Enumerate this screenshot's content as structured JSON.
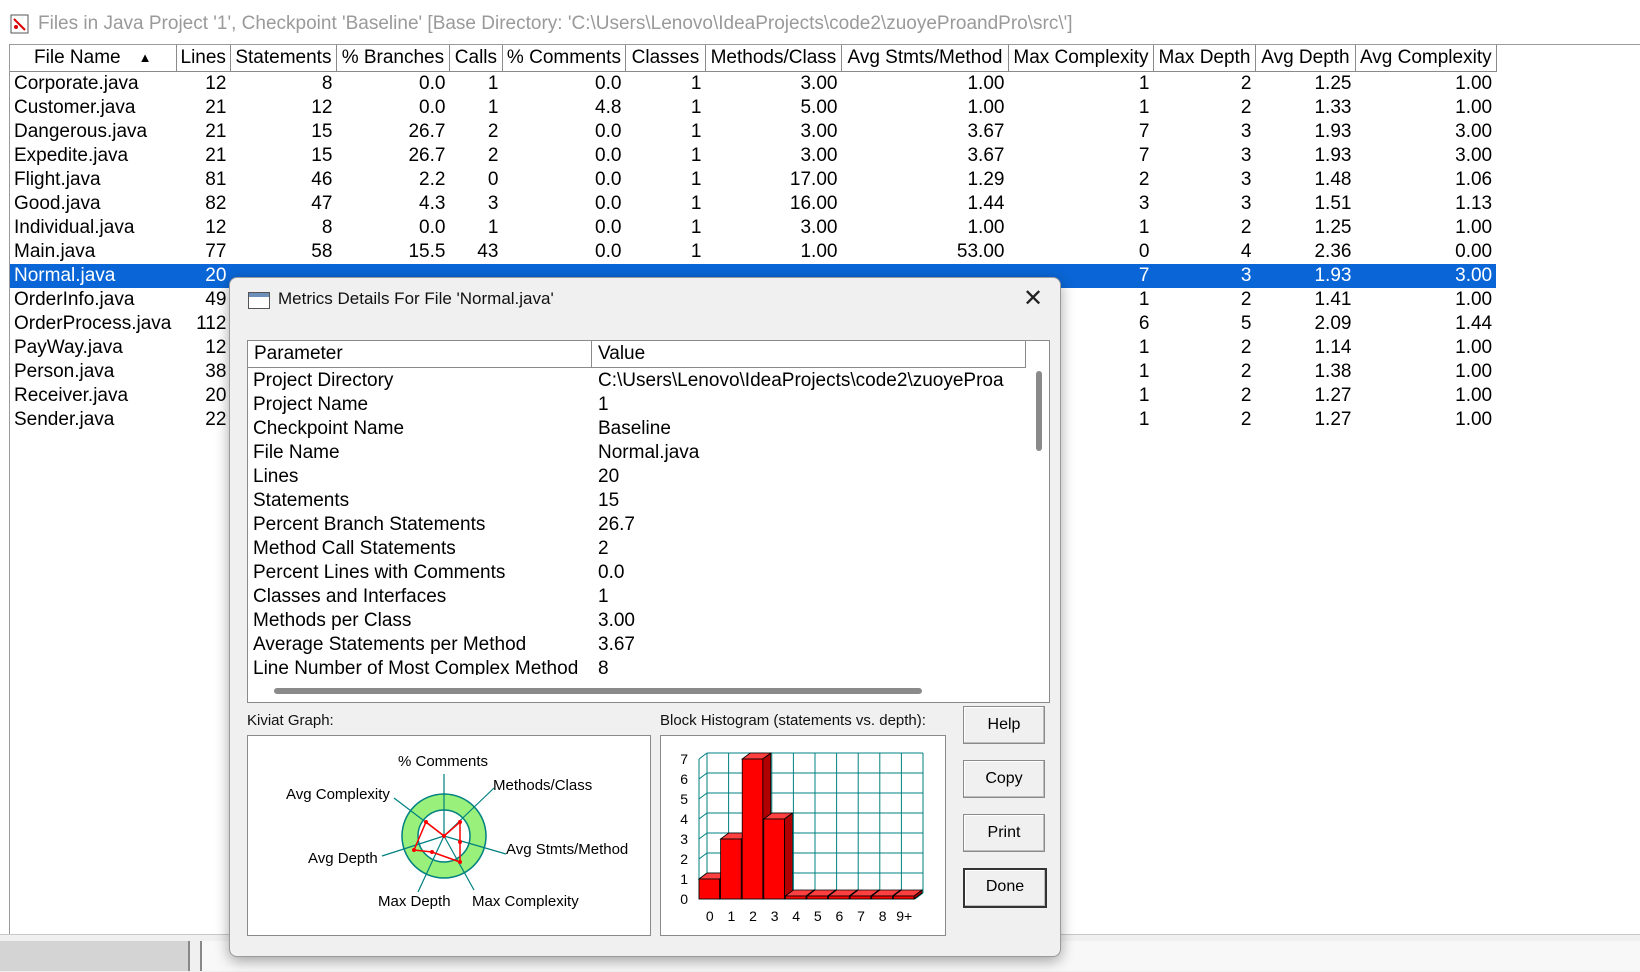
{
  "window": {
    "title": "Files in Java Project '1', Checkpoint 'Baseline'  [Base Directory: 'C:\\Users\\Lenovo\\IdeaProjects\\code2\\zuoyeProandPro\\src\\']"
  },
  "table": {
    "columns": [
      "File Name",
      "Lines",
      "Statements",
      "% Branches",
      "Calls",
      "% Comments",
      "Classes",
      "Methods/Class",
      "Avg Stmts/Method",
      "Max Complexity",
      "Max Depth",
      "Avg Depth",
      "Avg Complexity"
    ],
    "sorted_column": "File Name",
    "selected_row": "Normal.java",
    "rows": [
      [
        "Corporate.java",
        "12",
        "8",
        "0.0",
        "1",
        "0.0",
        "1",
        "3.00",
        "1.00",
        "1",
        "2",
        "1.25",
        "1.00"
      ],
      [
        "Customer.java",
        "21",
        "12",
        "0.0",
        "1",
        "4.8",
        "1",
        "5.00",
        "1.00",
        "1",
        "2",
        "1.33",
        "1.00"
      ],
      [
        "Dangerous.java",
        "21",
        "15",
        "26.7",
        "2",
        "0.0",
        "1",
        "3.00",
        "3.67",
        "7",
        "3",
        "1.93",
        "3.00"
      ],
      [
        "Expedite.java",
        "21",
        "15",
        "26.7",
        "2",
        "0.0",
        "1",
        "3.00",
        "3.67",
        "7",
        "3",
        "1.93",
        "3.00"
      ],
      [
        "Flight.java",
        "81",
        "46",
        "2.2",
        "0",
        "0.0",
        "1",
        "17.00",
        "1.29",
        "2",
        "3",
        "1.48",
        "1.06"
      ],
      [
        "Good.java",
        "82",
        "47",
        "4.3",
        "3",
        "0.0",
        "1",
        "16.00",
        "1.44",
        "3",
        "3",
        "1.51",
        "1.13"
      ],
      [
        "Individual.java",
        "12",
        "8",
        "0.0",
        "1",
        "0.0",
        "1",
        "3.00",
        "1.00",
        "1",
        "2",
        "1.25",
        "1.00"
      ],
      [
        "Main.java",
        "77",
        "58",
        "15.5",
        "43",
        "0.0",
        "1",
        "1.00",
        "53.00",
        "0",
        "4",
        "2.36",
        "0.00"
      ],
      [
        "Normal.java",
        "20",
        "",
        "",
        "",
        "",
        "",
        "",
        "",
        "7",
        "3",
        "1.93",
        "3.00"
      ],
      [
        "OrderInfo.java",
        "49",
        "",
        "",
        "",
        "",
        "",
        "",
        "",
        "1",
        "2",
        "1.41",
        "1.00"
      ],
      [
        "OrderProcess.java",
        "112",
        "",
        "",
        "",
        "",
        "",
        "",
        "",
        "6",
        "5",
        "2.09",
        "1.44"
      ],
      [
        "PayWay.java",
        "12",
        "",
        "",
        "",
        "",
        "",
        "",
        "",
        "1",
        "2",
        "1.14",
        "1.00"
      ],
      [
        "Person.java",
        "38",
        "",
        "",
        "",
        "",
        "",
        "",
        "",
        "1",
        "2",
        "1.38",
        "1.00"
      ],
      [
        "Receiver.java",
        "20",
        "",
        "",
        "",
        "",
        "",
        "",
        "",
        "1",
        "2",
        "1.27",
        "1.00"
      ],
      [
        "Sender.java",
        "22",
        "",
        "",
        "",
        "",
        "",
        "",
        "",
        "1",
        "2",
        "1.27",
        "1.00"
      ]
    ]
  },
  "dialog": {
    "title": "Metrics Details For File 'Normal.java'",
    "close_glyph": "✕",
    "list_headers": [
      "Parameter",
      "Value"
    ],
    "params": [
      {
        "p": "Project Directory",
        "v": "C:\\Users\\Lenovo\\IdeaProjects\\code2\\zuoyeProa"
      },
      {
        "p": "Project Name",
        "v": "1"
      },
      {
        "p": "Checkpoint Name",
        "v": "Baseline"
      },
      {
        "p": "File Name",
        "v": "Normal.java"
      },
      {
        "p": "Lines",
        "v": "20"
      },
      {
        "p": "Statements",
        "v": "15"
      },
      {
        "p": "Percent Branch Statements",
        "v": "26.7"
      },
      {
        "p": "Method Call Statements",
        "v": "2"
      },
      {
        "p": "Percent Lines with Comments",
        "v": "0.0"
      },
      {
        "p": "Classes and Interfaces",
        "v": "1"
      },
      {
        "p": "Methods per Class",
        "v": "3.00"
      },
      {
        "p": "Average Statements per Method",
        "v": "3.67"
      },
      {
        "p": "Line Number of Most Complex Method",
        "v": "8"
      }
    ],
    "kiviat_label": "Kiviat Graph:",
    "kiviat_axes": [
      "% Comments",
      "Methods/Class",
      "Avg Stmts/Method",
      "Max Complexity",
      "Max Depth",
      "Avg Depth",
      "Avg Complexity"
    ],
    "histogram_label": "Block Histogram (statements vs. depth):",
    "buttons": {
      "help": "Help",
      "copy": "Copy",
      "print": "Print",
      "done": "Done"
    }
  },
  "chart_data": {
    "type": "bar",
    "categories": [
      "0",
      "1",
      "2",
      "3",
      "4",
      "5",
      "6",
      "7",
      "8",
      "9+"
    ],
    "values": [
      1,
      3,
      7,
      4,
      0,
      0,
      0,
      0,
      0,
      0
    ],
    "y_ticks": [
      "0",
      "1",
      "2",
      "3",
      "4",
      "5",
      "6",
      "7"
    ],
    "ylim": [
      0,
      7
    ],
    "grid": true,
    "bar_color": "#ff0000",
    "grid_color": "#008080"
  }
}
